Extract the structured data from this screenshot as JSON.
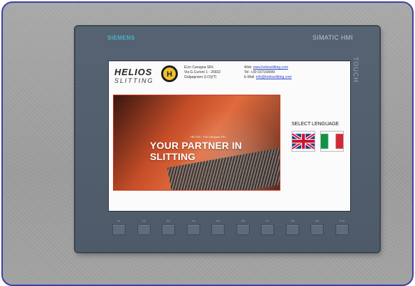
{
  "device": {
    "brand": "SIEMENS",
    "model": "SIMATIC HMI",
    "touch_label": "TOUCH"
  },
  "logo": {
    "top_text": "HELIOS",
    "bottom_text": "SLITTING",
    "badge_text": "H"
  },
  "company": {
    "name": "ELin Cavagna SRL",
    "address": "Via G.Curioni 1 - 26832",
    "city": "Galgagnano (LO)(IT)"
  },
  "contact": {
    "web_label": "Web:",
    "web": "www.heliosslitting.com",
    "tel_label": "Tel:",
    "tel": "+39 037168099",
    "email_label": "E-Mail:",
    "email": "info@heliosslitting.com"
  },
  "hero": {
    "small_text": "HELIOS - Elin Cavagna SRL",
    "title": "YOUR PARTNER IN SLITTING"
  },
  "language": {
    "title": "SELECT LENGUAGE",
    "options": [
      {
        "name": "English",
        "icon": "uk-flag-icon"
      },
      {
        "name": "Italian",
        "icon": "italy-flag-icon"
      }
    ]
  },
  "function_keys": [
    "F1",
    "F2",
    "F3",
    "F4",
    "F5",
    "F6",
    "F7",
    "F8",
    "F9",
    "F10"
  ],
  "colors": {
    "accent": "#48b7c6",
    "bezel": "#566373",
    "hero_border": "#c83a2a"
  }
}
